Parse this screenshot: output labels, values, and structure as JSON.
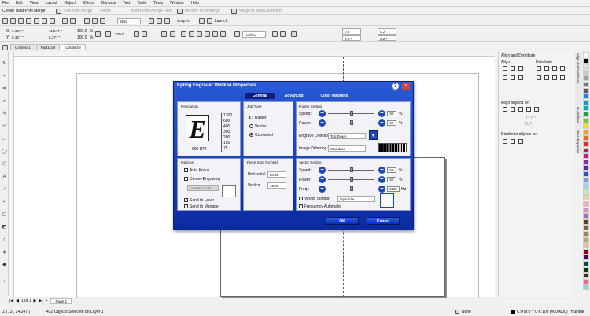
{
  "menu": [
    "File",
    "Edit",
    "View",
    "Layout",
    "Object",
    "Effects",
    "Bitmaps",
    "Text",
    "Table",
    "Tools",
    "Window",
    "Help"
  ],
  "toolbar1": {
    "create": "Create Toad Print Merge",
    "edit": "Edit Print Merge",
    "fields": "Fields",
    "insert": "Insert Print Merge Field",
    "perform": "Perform Print Merge",
    "merge_new": "Merge to New Document"
  },
  "toolbar2": {
    "zoom": "25%",
    "snap": "Snap To",
    "launch": "Launch"
  },
  "propbar": {
    "x": "6.173 \"",
    "y": "6.327 \"",
    "w": "11.547 \"",
    "h": "6.277 \"",
    "sx": "100.0",
    "sy": "100.0",
    "pct": "%",
    "angle": "270.0",
    "outline": "Hairline",
    "nudge1": "0.2 \"",
    "nudge2": "0.2 \"",
    "dup1": "0.2 \"",
    "dup2": "0.2 \""
  },
  "tabs": [
    "Untitled-1",
    "Part1.cdr",
    "Untitled-2"
  ],
  "dialog": {
    "title": "Epilog Engraver WinX64 Properties",
    "tabs": [
      "General",
      "Advanced",
      "Color Mapping"
    ],
    "resolution": {
      "label": "Resolution",
      "dpi_text": "600 DPI",
      "letter": "E",
      "values": [
        "1200",
        "600",
        "400",
        "300",
        "200",
        "150",
        "75"
      ]
    },
    "job": {
      "label": "Job Type",
      "options": [
        "Raster",
        "Vector",
        "Combined"
      ],
      "selected": "Combined"
    },
    "raster": {
      "label": "Raster Setting",
      "speed": "Speed:",
      "speed_val": "50",
      "power": "Power:",
      "power_val": "50",
      "pct": "%",
      "direction": "Engrave Direction:",
      "direction_val": "Top Down",
      "dithering": "Image Dithering:",
      "dithering_val": "Standard"
    },
    "options": {
      "label": "Options",
      "auto_focus": "Auto Focus",
      "center": "Center-Engraving",
      "center_btn": "Center-Center",
      "send_laser": "Send to Laser",
      "send_manager": "Send to Manager"
    },
    "piece": {
      "label": "Piece Size (inches)",
      "horizontal": "Horizontal",
      "h_val": "24.00",
      "vertical": "Vertical",
      "v_val": "12.00"
    },
    "vector": {
      "label": "Vector Setting",
      "speed": "Speed:",
      "speed_val": "50",
      "power": "Power:",
      "power_val": "50",
      "freq": "Freq.:",
      "freq_val": "2500",
      "hz": "Hz",
      "sorting": "Vector Sorting",
      "sorting_val": "Optimize",
      "freq_auto": "Frequency Automatic"
    },
    "ok": "OK",
    "cancel": "Cancel"
  },
  "right": {
    "title": "Align and Distribute",
    "align": "Align",
    "distribute": "Distribute",
    "align_to": "Align objects to:",
    "x": "12.0 \"",
    "y": "0.0 \"",
    "dist_to": "Distribute objects to:",
    "vtabs": [
      "Align and Distribute",
      "Guidelines",
      "Text Properties"
    ]
  },
  "status": {
    "coords": "2.713 , 24.247 )",
    "msg": "432 Objects Selected on Layer 1",
    "fill": "None",
    "color": "C:0 M:0 Y:0 K:100 (#000000)",
    "outline": "Hairline",
    "page_nav": "1 of 1",
    "page": "Page 1"
  },
  "palette": [
    "#ffffff",
    "#000000",
    "#e0e0e0",
    "#c8c8c8",
    "#a0a0a0",
    "#787878",
    "#5a5a5a",
    "#2c7de0",
    "#00a0e0",
    "#00b0a0",
    "#20a040",
    "#80c040",
    "#f0e020",
    "#f0a020",
    "#e07020",
    "#e03020",
    "#c02040",
    "#c02080",
    "#8030a0",
    "#5030a0",
    "#3050c0",
    "#70a0e0",
    "#a0d0f0",
    "#d0e8c0",
    "#f0d0a0",
    "#f0b0b0",
    "#d090c0",
    "#a070b0",
    "#604020",
    "#806040",
    "#a08060",
    "#c0a080",
    "#e0c0a0",
    "#8a0a0a",
    "#4a0a4a",
    "#0a4a4a",
    "#0a3a0a",
    "#3a3a0a",
    "#f06090",
    "#90d0d0"
  ]
}
